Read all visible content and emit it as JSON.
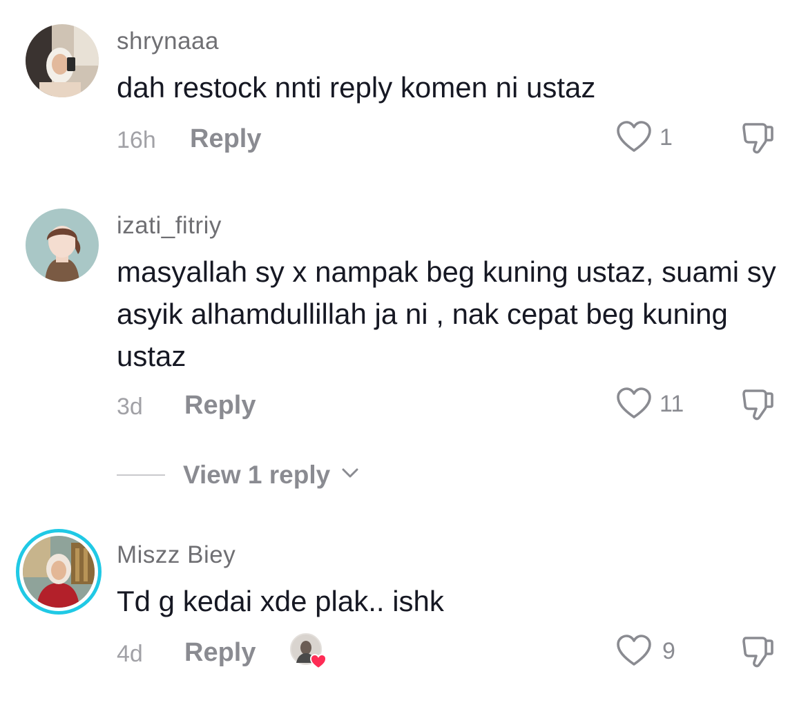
{
  "comments": [
    {
      "username": "shrynaaa",
      "text": "dah restock nnti reply komen ni ustaz",
      "time": "16h",
      "reply_label": "Reply",
      "likes": "1"
    },
    {
      "username": "izati_fitriy",
      "text": "masyallah sy x nampak beg kuning ustaz, suami sy asyik alhamdullillah ja ni , nak cepat beg kuning ustaz",
      "time": "3d",
      "reply_label": "Reply",
      "likes": "11",
      "view_replies": "View 1 reply"
    },
    {
      "username": "Miszz Biey",
      "text": "Td g kedai xde plak.. ishk",
      "time": "4d",
      "reply_label": "Reply",
      "likes": "9"
    }
  ],
  "icons": {
    "like": "heart-outline-icon",
    "dislike": "thumbs-down-icon",
    "chevron": "chevron-down-icon",
    "creator_liked": "creator-liked-heart-icon"
  },
  "colors": {
    "text": "#161823",
    "muted": "#8a8b91",
    "story_ring": "#20c9e5",
    "heart_badge": "#fe2c55"
  }
}
